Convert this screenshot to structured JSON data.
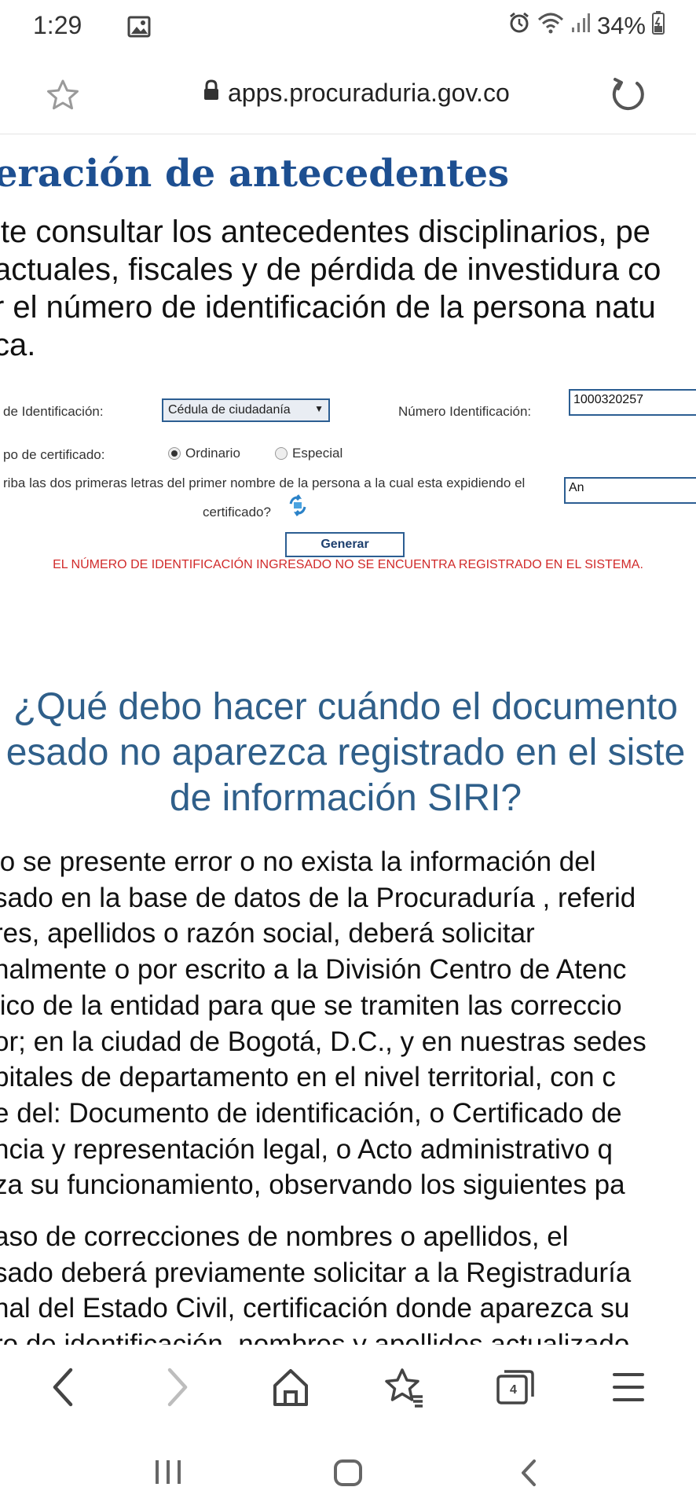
{
  "status_bar": {
    "time": "1:29",
    "battery": "34%",
    "icons": [
      "image-icon",
      "alarm-icon",
      "wifi-icon",
      "signal-icon",
      "battery-icon"
    ]
  },
  "browser": {
    "url": "apps.procuraduria.gov.co"
  },
  "page": {
    "title": "eración de antecedentes",
    "intro_lines": [
      "ite consultar los antecedentes disciplinarios, pe",
      "actuales, fiscales y de pérdida de investidura co",
      "r el número de identificación de la persona natu",
      "ca."
    ]
  },
  "form": {
    "tipo_id_label": "de Identificación:",
    "tipo_id_value": "Cédula de ciudadanía",
    "numero_label": "Número Identificación:",
    "numero_value": "1000320257",
    "cert_label": "po de certificado:",
    "option_ordinario": "Ordinario",
    "option_especial": "Especial",
    "selected_option": "Ordinario",
    "letters_label_1": "riba las dos primeras letras del primer nombre de la persona a la cual esta expidiendo el",
    "letters_label_2": "certificado?",
    "letters_value": "An",
    "generate_button": "Generar",
    "error_message": "EL NÚMERO DE IDENTIFICACIÓN INGRESADO NO SE ENCUENTRA REGISTRADO EN EL SISTEMA."
  },
  "faq": {
    "title_lines": [
      "¿Qué debo hacer cuándo el documento",
      "esado no aparezca registrado en el siste",
      "de información SIRI?"
    ],
    "paragraph1_lines": [
      "lo se presente error o no exista la información del",
      "sado en la base de datos de la Procuraduría , referid",
      "res, apellidos o razón social, deberá solicitar",
      "nalmente o por escrito a la División Centro de Atenc",
      "lico de la entidad para que se tramiten las correccio",
      "or; en la ciudad de Bogotá, D.C., y en nuestras sedes",
      "pitales de departamento en el nivel territorial, con c",
      "e del: Documento de identificación, o Certificado de",
      "ncia y representación legal, o Acto administrativo q",
      "za su funcionamiento, observando los siguientes pa"
    ],
    "paragraph2_lines": [
      "aso de correcciones de nombres o apellidos, el",
      "sado deberá previamente solicitar a la Registraduría",
      "nal del Estado Civil, certificación donde aparezca su",
      "ro de identificación, nombres y apellidos actualizado"
    ]
  },
  "bottom_nav": {
    "tab_count": "4",
    "icons": [
      "back-icon",
      "forward-icon",
      "home-icon",
      "bookmarks-icon",
      "tabs-icon",
      "menu-icon"
    ]
  },
  "system_nav": {
    "icons": [
      "recent-apps-icon",
      "home-button-icon",
      "system-back-icon"
    ]
  }
}
